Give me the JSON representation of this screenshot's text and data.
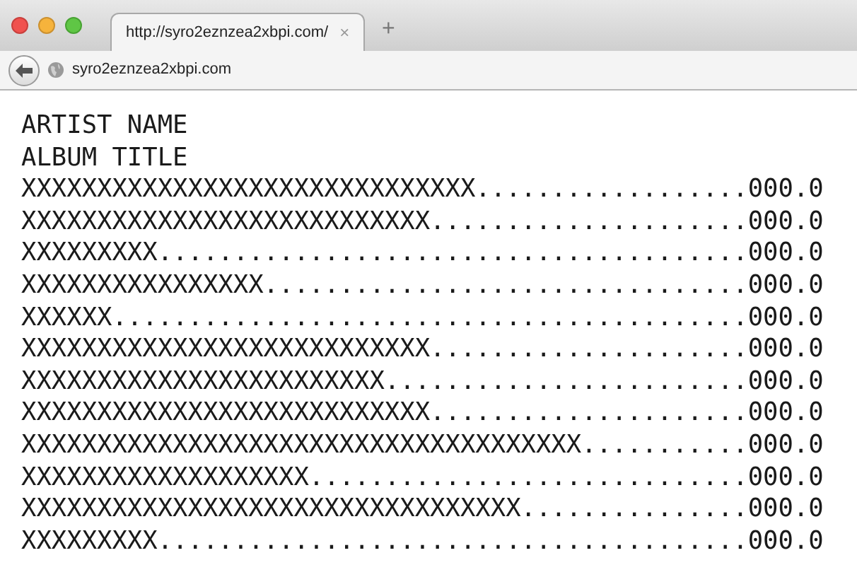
{
  "browser": {
    "tab": {
      "title": "http://syro2eznzea2xbpi.com/",
      "close": "×",
      "selected": true
    },
    "new_tab": "+",
    "url": "syro2eznzea2xbpi.com"
  },
  "page": {
    "artist": "ARTIST NAME",
    "album": "ALBUM TITLE",
    "tracks": [
      "XXXXXXXXXXXXXXXXXXXXXXXXXXXXXX..................000.0",
      "XXXXXXXXXXXXXXXXXXXXXXXXXXX.....................000.0",
      "XXXXXXXXX.......................................000.0",
      "XXXXXXXXXXXXXXXX................................000.0",
      "XXXXXX..........................................000.0",
      "XXXXXXXXXXXXXXXXXXXXXXXXXXX.....................000.0",
      "XXXXXXXXXXXXXXXXXXXXXXXX........................000.0",
      "XXXXXXXXXXXXXXXXXXXXXXXXXXX.....................000.0",
      "XXXXXXXXXXXXXXXXXXXXXXXXXXXXXXXXXXXXX...........000.0",
      "XXXXXXXXXXXXXXXXXXX.............................000.0",
      "XXXXXXXXXXXXXXXXXXXXXXXXXXXXXXXXX...............000.0",
      "XXXXXXXXX.......................................000.0"
    ]
  }
}
